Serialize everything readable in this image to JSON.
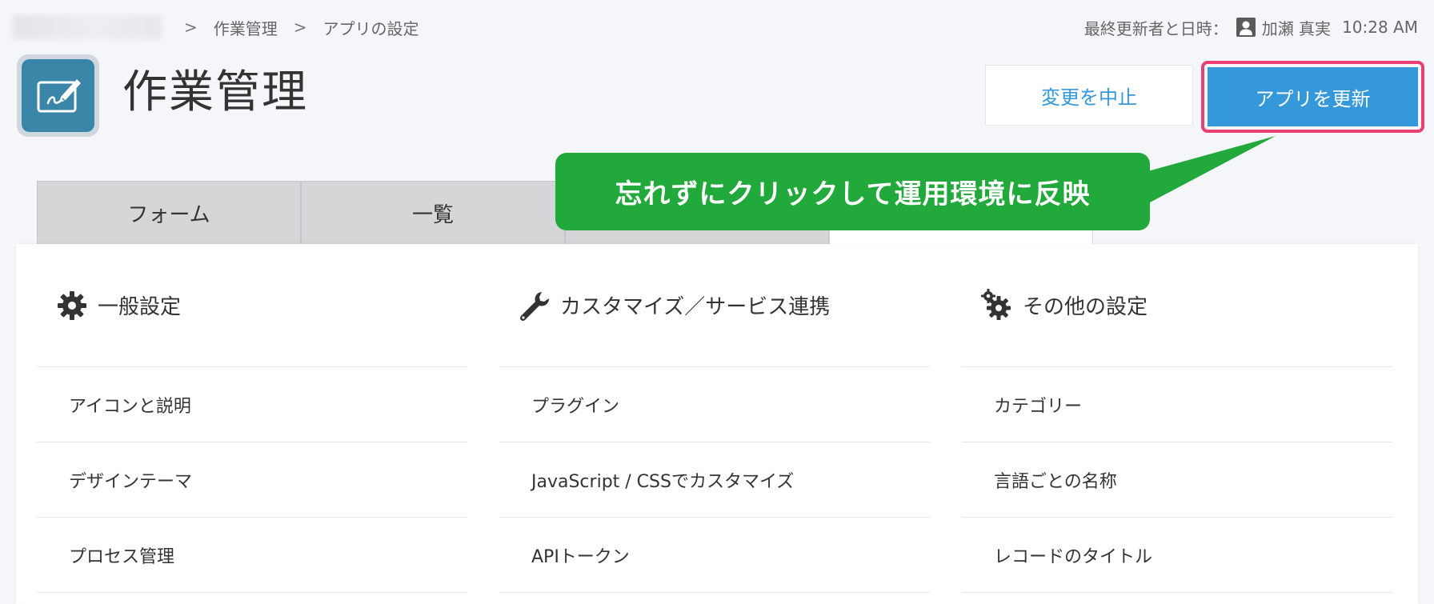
{
  "breadcrumb": {
    "items": [
      "作業管理",
      "アプリの設定"
    ],
    "separator": ">"
  },
  "updated": {
    "label": "最終更新者と日時：",
    "user": "加瀬 真実",
    "time": "10:28 AM"
  },
  "app": {
    "title": "作業管理",
    "icon": "pencil-tablet-icon"
  },
  "buttons": {
    "cancel_label": "変更を中止",
    "update_label": "アプリを更新"
  },
  "tabs": [
    {
      "label": "フォーム",
      "active": false
    },
    {
      "label": "一覧",
      "active": false
    },
    {
      "label": "",
      "active": false
    },
    {
      "label": "",
      "active": true
    }
  ],
  "callout": {
    "text": "忘れずにクリックして運用環境に反映"
  },
  "sections": [
    {
      "title": "一般設定",
      "icon": "gear-icon",
      "items": [
        "アイコンと説明",
        "デザインテーマ",
        "プロセス管理"
      ]
    },
    {
      "title": "カスタマイズ／サービス連携",
      "icon": "wrench-icon",
      "items": [
        "プラグイン",
        "JavaScript / CSSでカスタマイズ",
        "APIトークン"
      ]
    },
    {
      "title": "その他の設定",
      "icon": "gears-icon",
      "items": [
        "カテゴリー",
        "言語ごとの名称",
        "レコードのタイトル"
      ]
    }
  ],
  "colors": {
    "primary": "#3498db",
    "highlight": "#ea3f72",
    "callout": "#22a93b",
    "app_icon": "#3a86a8"
  }
}
